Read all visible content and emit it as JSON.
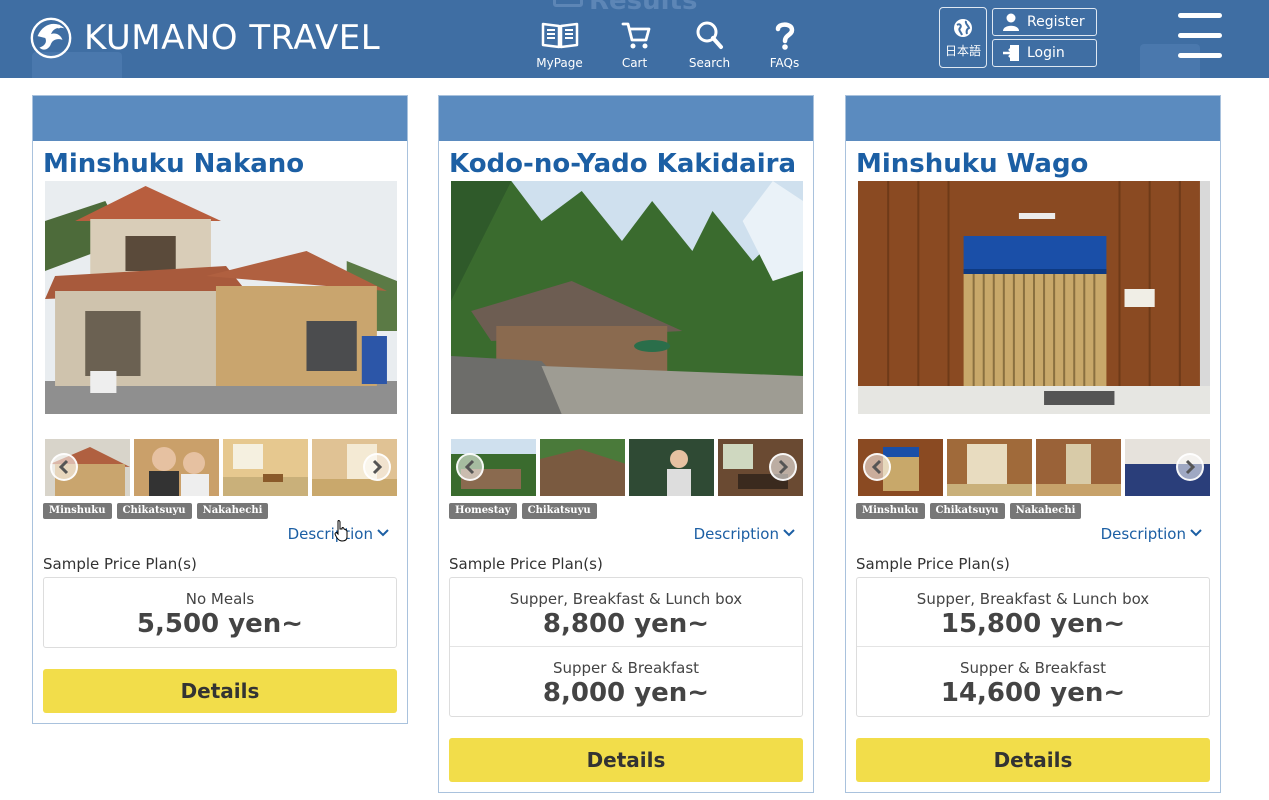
{
  "header": {
    "brand": "KUMANO TRAVEL",
    "ghost_title": "Results",
    "nav": [
      {
        "label": "MyPage",
        "icon": "book-icon"
      },
      {
        "label": "Cart",
        "icon": "cart-icon"
      },
      {
        "label": "Search",
        "icon": "search-icon"
      },
      {
        "label": "FAQs",
        "icon": "question-icon"
      }
    ],
    "language_label": "日本語",
    "register_label": "Register",
    "login_label": "Login"
  },
  "cards": [
    {
      "title": "Minshuku Nakano",
      "tags": [
        "Minshuku",
        "Chikatsuyu",
        "Nakahechi"
      ],
      "description_label": "Description",
      "sample_label": "Sample Price Plan(s)",
      "plans": [
        {
          "name": "No Meals",
          "price": "5,500 yen~"
        }
      ],
      "details_label": "Details"
    },
    {
      "title": "Kodo-no-Yado Kakidaira",
      "tags": [
        "Homestay",
        "Chikatsuyu"
      ],
      "description_label": "Description",
      "sample_label": "Sample Price Plan(s)",
      "plans": [
        {
          "name": "Supper, Breakfast & Lunch box",
          "price": "8,800 yen~"
        },
        {
          "name": "Supper & Breakfast",
          "price": "8,000 yen~"
        }
      ],
      "details_label": "Details"
    },
    {
      "title": "Minshuku Wago",
      "tags": [
        "Minshuku",
        "Chikatsuyu",
        "Nakahechi"
      ],
      "description_label": "Description",
      "sample_label": "Sample Price Plan(s)",
      "plans": [
        {
          "name": "Supper, Breakfast & Lunch box",
          "price": "15,800 yen~"
        },
        {
          "name": "Supper & Breakfast",
          "price": "14,600 yen~"
        }
      ],
      "details_label": "Details"
    }
  ],
  "colors": {
    "header_bg": "#3f6ea3",
    "card_top": "#5b8bbf",
    "title": "#1c5fa4",
    "details_button": "#f2dd4a"
  }
}
